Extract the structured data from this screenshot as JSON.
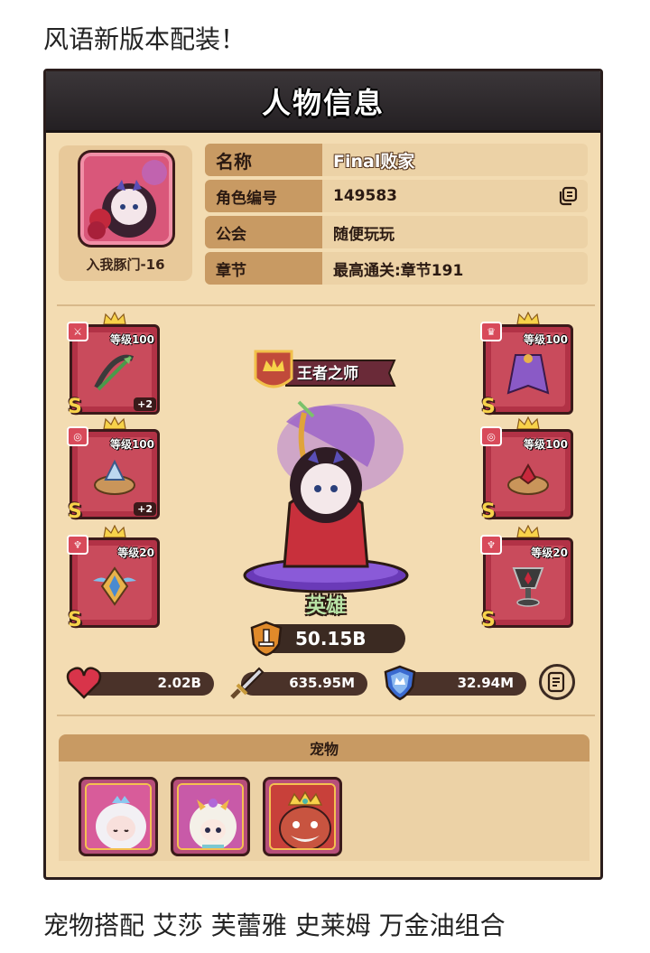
{
  "post": {
    "top_caption": "风语新版本配装！",
    "bottom_caption": "宠物搭配 艾莎 芙蕾雅 史莱姆 万金油组合"
  },
  "panel": {
    "title": "人物信息"
  },
  "profile": {
    "avatar_name": "入我豚门-16",
    "rows": [
      {
        "key": "名称",
        "value": "Final败家"
      },
      {
        "key": "角色编号",
        "value": "149583"
      },
      {
        "key": "公会",
        "value": "随便玩玩"
      },
      {
        "key": "章节",
        "value": "最高通关:章节191"
      }
    ]
  },
  "equipment": {
    "left": [
      {
        "slot_icon": "sword-icon",
        "level": "等级100",
        "rank": "S",
        "plus": "+2",
        "art": "bow-icon"
      },
      {
        "slot_icon": "ring-icon",
        "level": "等级100",
        "rank": "S",
        "plus": "+2",
        "art": "gem-ring-icon"
      },
      {
        "slot_icon": "necklace-icon",
        "level": "等级20",
        "rank": "S",
        "plus": "",
        "art": "wing-badge-icon"
      }
    ],
    "right": [
      {
        "slot_icon": "armor-icon",
        "level": "等级100",
        "rank": "S",
        "plus": "",
        "art": "cape-icon"
      },
      {
        "slot_icon": "ring-icon",
        "level": "等级100",
        "rank": "S",
        "plus": "",
        "art": "ruby-ring-icon"
      },
      {
        "slot_icon": "necklace-icon",
        "level": "等级20",
        "rank": "S",
        "plus": "",
        "art": "chalice-icon"
      }
    ]
  },
  "hero": {
    "rank_title": "王者之师",
    "label": "英雄",
    "power": "50.15B"
  },
  "stats": {
    "hp": "2.02B",
    "attack": "635.95M",
    "defense": "32.94M"
  },
  "pets": {
    "header": "宠物",
    "items": [
      "艾莎",
      "芙蕾雅",
      "史莱姆"
    ]
  },
  "colors": {
    "panel_bg": "#f3dcb2",
    "header_bg": "#2f2a2d",
    "equip_red": "#b23246",
    "rank_gold": "#f7d24a"
  }
}
